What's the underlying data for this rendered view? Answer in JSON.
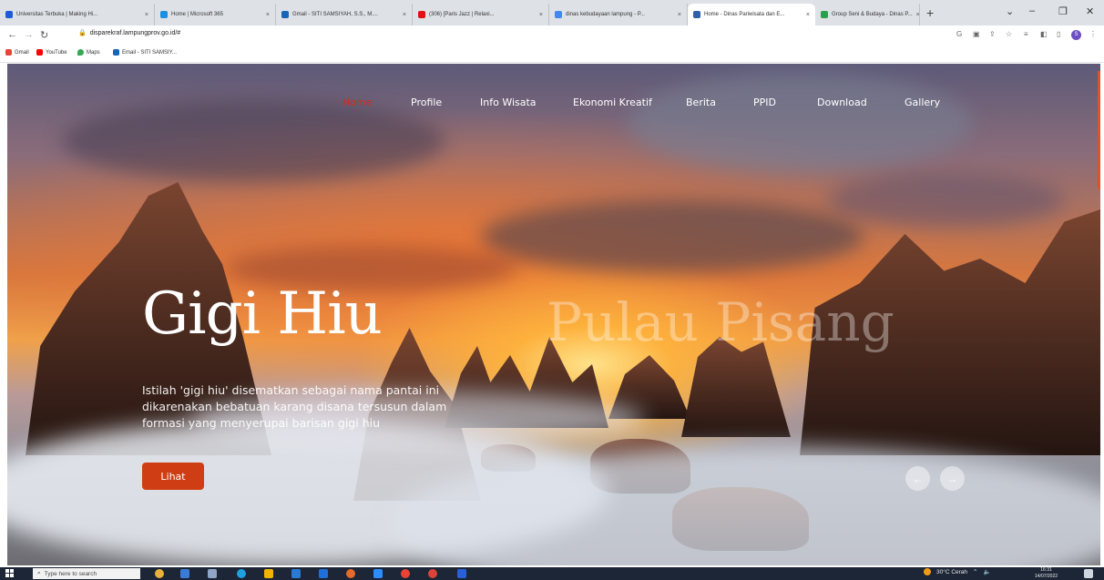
{
  "browser": {
    "tabs": [
      {
        "label": "Universitas Terbuka | Making Hi...",
        "color": "#1f5bd6"
      },
      {
        "label": "Home | Microsoft 365",
        "color": "#1b8fe0"
      },
      {
        "label": "Gmail - SITI SAMSIYAH, S.S., M....",
        "color": "#1665b8"
      },
      {
        "label": "(306) [Paris Jazz | Relaxi...",
        "color": "#e11212"
      },
      {
        "label": "dinas kebudayaan lampung - P...",
        "color": "#4285f4"
      },
      {
        "label": "Home - Dinas Pariwisata dan E...",
        "color": "#2f5fa8"
      },
      {
        "label": "Group Seni & Budaya - Dinas P...",
        "color": "#2c9f4f"
      }
    ],
    "tab_close": "×",
    "new_tab": "+",
    "url": "disparekraf.lampungprov.go.id/#",
    "bookmarks": [
      {
        "label": "Gmail",
        "color": "#ea4335"
      },
      {
        "label": "YouTube",
        "color": "#ff0000"
      },
      {
        "label": "Maps",
        "color": "#34a853"
      },
      {
        "label": "Email - SITI SAMSIY...",
        "color": "#1665b8"
      }
    ],
    "profile_initial": "S"
  },
  "site": {
    "nav": [
      "Home",
      "Profile",
      "Info Wisata",
      "Ekonomi Kreatif",
      "Berita",
      "PPID",
      "Download",
      "Gallery"
    ],
    "active_nav": "Home",
    "accent": "#d42a1c",
    "slide_title": "Gigi Hiu",
    "next_slide_title": "Pulau Pisang",
    "slide_description": "Istilah 'gigi hiu' disematkan sebagai nama pantai ini dikarenakan bebatuan karang disana tersusun dalam formasi yang menyerupai barisan gigi hiu",
    "cta_label": "Lihat",
    "cta_color": "#cf3d14",
    "prev_arrow": "←",
    "next_arrow": "→"
  },
  "taskbar": {
    "search_placeholder": "Type here to search",
    "weather": "30°C Cerah",
    "time": "16:31",
    "date": "14/07/2022"
  }
}
